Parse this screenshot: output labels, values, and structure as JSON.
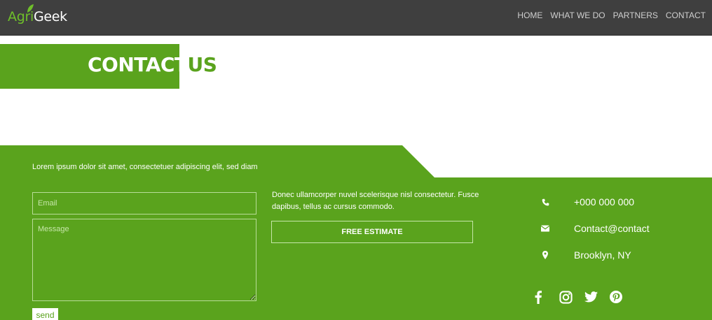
{
  "header": {
    "logo": {
      "part1": "Agri",
      "part2": "Geek"
    },
    "nav": [
      "HOME",
      "WHAT WE DO",
      "PARTNERS",
      "CONTACT"
    ]
  },
  "banner": {
    "title_main": "CONTACT",
    "title_overflow": "US"
  },
  "form": {
    "intro": "Lorem ipsum dolor sit amet, consectetuer adipiscing elit, sed diam",
    "email_placeholder": "Email",
    "message_placeholder": "Message",
    "send_label": "send"
  },
  "middle": {
    "text": "Donec ullamcorper nuvel scelerisque nisl consectetur. Fusce dapibus, tellus ac cursus commodo.",
    "button_label": "FREE ESTIMATE"
  },
  "contact": {
    "phone": "+000 000 000",
    "email": "Contact@contact",
    "location": "Brooklyn, NY"
  },
  "socials": [
    "facebook-icon",
    "instagram-icon",
    "twitter-icon",
    "pinterest-icon"
  ],
  "colors": {
    "green": "#5aa31d",
    "header_bg": "#3f3f3f",
    "logo_green": "#6fbf2a"
  }
}
